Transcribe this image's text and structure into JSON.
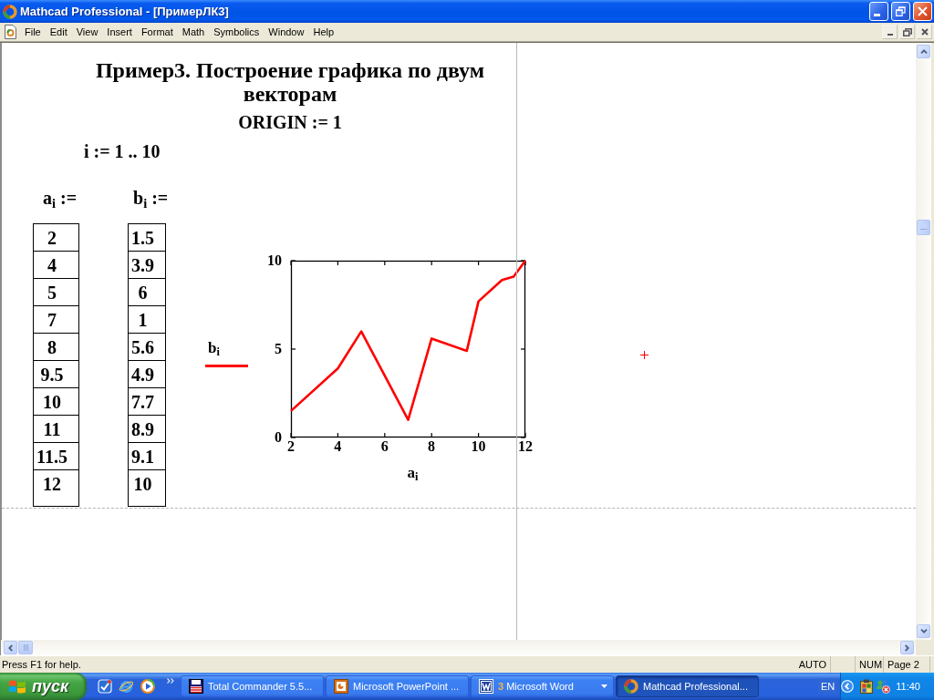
{
  "window": {
    "title": "Mathcad Professional - [ПримерЛК3]"
  },
  "menu_bar": {
    "items": [
      "File",
      "Edit",
      "View",
      "Insert",
      "Format",
      "Math",
      "Symbolics",
      "Window",
      "Help"
    ]
  },
  "worksheet": {
    "heading": "Пример3. Построение графика по двум векторам",
    "origin_definition": "ORIGIN := 1",
    "range_definition": "i := 1 .. 10",
    "vectors": [
      {
        "definition": "a$_{i}$ :=",
        "values": [
          "2",
          "4",
          "5",
          "7",
          "8",
          "9.5",
          "10",
          "11",
          "11.5",
          "12"
        ]
      },
      {
        "definition": "b$_{i}$ :=",
        "values": [
          "1.5",
          "3.9",
          "6",
          "1",
          "5.6",
          "4.9",
          "7.7",
          "8.9",
          "9.1",
          "10"
        ]
      }
    ],
    "plot": {
      "chart_data": {
        "type": "line",
        "xlabel": "a$_{i}$",
        "x": [
          2,
          4,
          5,
          7,
          8,
          9.5,
          10,
          11,
          11.5,
          12
        ],
        "series": [
          {
            "name": "b$_{i}$",
            "color": "#ff0000",
            "values": [
              1.5,
              3.9,
              6,
              1,
              5.6,
              4.9,
              7.7,
              8.9,
              9.1,
              10
            ]
          }
        ],
        "xlim": [
          2,
          12
        ],
        "ylim": [
          0,
          10
        ],
        "xticks": [
          2,
          4,
          6,
          8,
          10,
          12
        ],
        "yticks": [
          0,
          5,
          10
        ]
      }
    }
  },
  "status_bar": {
    "message": "Press F1 for help.",
    "panels": [
      "AUTO",
      "NUM",
      "Page 2"
    ]
  },
  "taskbar": {
    "start_button": "пуск",
    "tasks": [
      {
        "label": "Total Commander 5.5...",
        "selected": false
      },
      {
        "label": "Microsoft PowerPoint ...",
        "selected": false
      },
      {
        "label": "Microsoft Word",
        "count": "3",
        "selected": false
      },
      {
        "label": "Mathcad Professional...",
        "selected": true
      }
    ],
    "language": "EN",
    "clock": "11:40"
  }
}
